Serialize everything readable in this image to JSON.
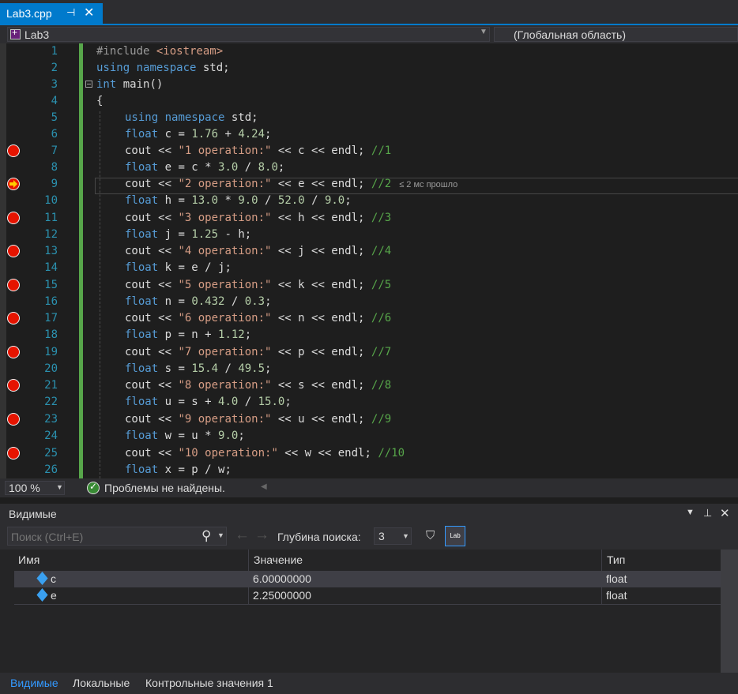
{
  "tab": {
    "title": "Lab3.cpp",
    "pin": "⊣",
    "close": "✕"
  },
  "nav": {
    "project": "Lab3",
    "scope": "(Глобальная область)"
  },
  "editor": {
    "lines": [
      {
        "n": "1"
      },
      {
        "n": "2"
      },
      {
        "n": "3"
      },
      {
        "n": "4"
      },
      {
        "n": "5"
      },
      {
        "n": "6"
      },
      {
        "n": "7"
      },
      {
        "n": "8"
      },
      {
        "n": "9"
      },
      {
        "n": "10"
      },
      {
        "n": "11"
      },
      {
        "n": "12"
      },
      {
        "n": "13"
      },
      {
        "n": "14"
      },
      {
        "n": "15"
      },
      {
        "n": "16"
      },
      {
        "n": "17"
      },
      {
        "n": "18"
      },
      {
        "n": "19"
      },
      {
        "n": "20"
      },
      {
        "n": "21"
      },
      {
        "n": "22"
      },
      {
        "n": "23"
      },
      {
        "n": "24"
      },
      {
        "n": "25"
      },
      {
        "n": "26"
      }
    ],
    "code": {
      "l1_a": "#include ",
      "l1_b": "<iostream>",
      "l2_a": "using",
      "l2_b": " ",
      "l2_c": "namespace",
      "l2_d": " std;",
      "l3_a": "int",
      "l3_b": " main()",
      "l4": "{",
      "l5_a": "using",
      "l5_c": "namespace",
      "l5_d": " std;",
      "l6_a": "float",
      "l6_b": " c = ",
      "l6_c": "1.76",
      "l6_d": " + ",
      "l6_e": "4.24",
      "l6_f": ";",
      "l7_a": "cout << ",
      "l7_b": "\"1 operation:\"",
      "l7_c": " << c << endl; ",
      "l7_d": "//1",
      "l8_a": "float",
      "l8_b": " e = c * ",
      "l8_c": "3.0",
      "l8_d": " / ",
      "l8_e": "8.0",
      "l8_f": ";",
      "l9_a": "cout << ",
      "l9_b": "\"2 operation:\"",
      "l9_c": " << e << endl; ",
      "l9_d": "//2",
      "l9_elapsed": "≤ 2 мс прошло",
      "l10_a": "float",
      "l10_b": " h = ",
      "l10_c": "13.0",
      "l10_d": " * ",
      "l10_e": "9.0",
      "l10_f": " / ",
      "l10_g": "52.0",
      "l10_h": " / ",
      "l10_i": "9.0",
      "l10_j": ";",
      "l11_a": "cout << ",
      "l11_b": "\"3 operation:\"",
      "l11_c": " << h << endl; ",
      "l11_d": "//3",
      "l12_a": "float",
      "l12_b": " j = ",
      "l12_c": "1.25",
      "l12_d": " - h;",
      "l13_a": "cout << ",
      "l13_b": "\"4 operation:\"",
      "l13_c": " << j << endl; ",
      "l13_d": "//4",
      "l14_a": "float",
      "l14_b": " k = e / j;",
      "l15_a": "cout << ",
      "l15_b": "\"5 operation:\"",
      "l15_c": " << k << endl; ",
      "l15_d": "//5",
      "l16_a": "float",
      "l16_b": " n = ",
      "l16_c": "0.432",
      "l16_d": " / ",
      "l16_e": "0.3",
      "l16_f": ";",
      "l17_a": "cout << ",
      "l17_b": "\"6 operation:\"",
      "l17_c": " << n << endl; ",
      "l17_d": "//6",
      "l18_a": "float",
      "l18_b": " p = n + ",
      "l18_c": "1.12",
      "l18_d": ";",
      "l19_a": "cout << ",
      "l19_b": "\"7 operation:\"",
      "l19_c": " << p << endl; ",
      "l19_d": "//7",
      "l20_a": "float",
      "l20_b": " s = ",
      "l20_c": "15.4",
      "l20_d": " / ",
      "l20_e": "49.5",
      "l20_f": ";",
      "l21_a": "cout << ",
      "l21_b": "\"8 operation:\"",
      "l21_c": " << s << endl; ",
      "l21_d": "//8",
      "l22_a": "float",
      "l22_b": " u = s + ",
      "l22_c": "4.0",
      "l22_d": " / ",
      "l22_e": "15.0",
      "l22_f": ";",
      "l23_a": "cout << ",
      "l23_b": "\"9 operation:\"",
      "l23_c": " << u << endl; ",
      "l23_d": "//9",
      "l24_a": "float",
      "l24_b": " w = u * ",
      "l24_c": "9.0",
      "l24_d": ";",
      "l25_a": "cout << ",
      "l25_b": "\"10 operation:\"",
      "l25_c": " << w << endl; ",
      "l25_d": "//10",
      "l26_a": "float",
      "l26_b": " x = p / w;"
    }
  },
  "status": {
    "zoom": "100 %",
    "problems": "Проблемы не найдены."
  },
  "autos": {
    "title": "Видимые",
    "search_placeholder": "Поиск (Ctrl+E)",
    "depth_label": "Глубина поиска:",
    "depth_value": "3",
    "hex_label": "Lab",
    "columns": {
      "name": "Имя",
      "value": "Значение",
      "type": "Тип"
    },
    "rows": [
      {
        "name": "c",
        "value": "6.00000000",
        "type": "float"
      },
      {
        "name": "e",
        "value": "2.25000000",
        "type": "float"
      }
    ],
    "tabs": {
      "autos": "Видимые",
      "locals": "Локальные",
      "watch": "Контрольные значения 1"
    }
  },
  "colors": {
    "accent": "#007acc",
    "breakpoint": "#e51400",
    "keyword": "#569cd6",
    "string": "#d69d85",
    "comment": "#57a64a",
    "linenumber": "#2b91af"
  }
}
